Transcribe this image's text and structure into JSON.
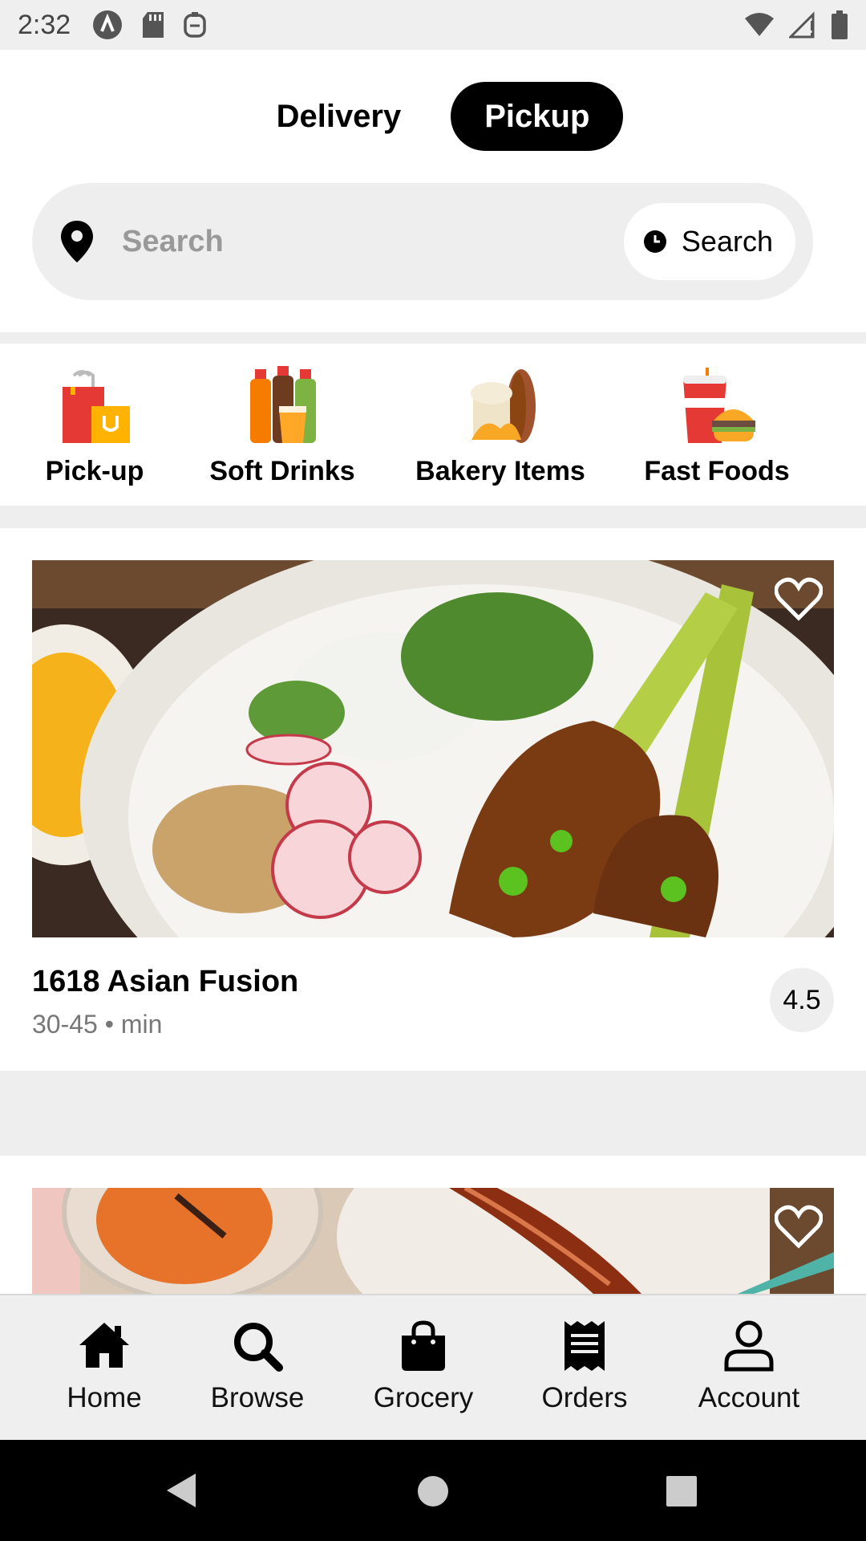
{
  "status_bar": {
    "time": "2:32",
    "left_icons": [
      "autotext-icon",
      "sd-card-icon",
      "clipboard-bot-icon"
    ],
    "right_icons": [
      "wifi-icon",
      "signal-icon",
      "battery-icon"
    ]
  },
  "mode_toggle": {
    "delivery_label": "Delivery",
    "pickup_label": "Pickup",
    "selected": "Pickup"
  },
  "search": {
    "placeholder": "Search",
    "schedule_label": "Search"
  },
  "categories": [
    {
      "label": "Pick-up",
      "icon": "shopping-bags-icon"
    },
    {
      "label": "Soft Drinks",
      "icon": "soda-bottles-icon"
    },
    {
      "label": "Bakery Items",
      "icon": "bread-icon"
    },
    {
      "label": "Fast Foods",
      "icon": "burger-drink-icon"
    }
  ],
  "restaurants": [
    {
      "name": "1618 Asian Fusion",
      "time": "30-45 • min",
      "rating": "4.5",
      "image": "grilled-skewers-bowl"
    },
    {
      "name": "",
      "time": "",
      "rating": "",
      "image": "bacon-and-iced-drink"
    }
  ],
  "bottom_nav": [
    {
      "label": "Home",
      "icon": "home-icon"
    },
    {
      "label": "Browse",
      "icon": "search-icon"
    },
    {
      "label": "Grocery",
      "icon": "shopping-bag-icon"
    },
    {
      "label": "Orders",
      "icon": "receipt-icon"
    },
    {
      "label": "Account",
      "icon": "person-icon"
    }
  ],
  "colors": {
    "accent": "#000000",
    "surface": "#eeeeee",
    "muted_text": "#777777"
  }
}
